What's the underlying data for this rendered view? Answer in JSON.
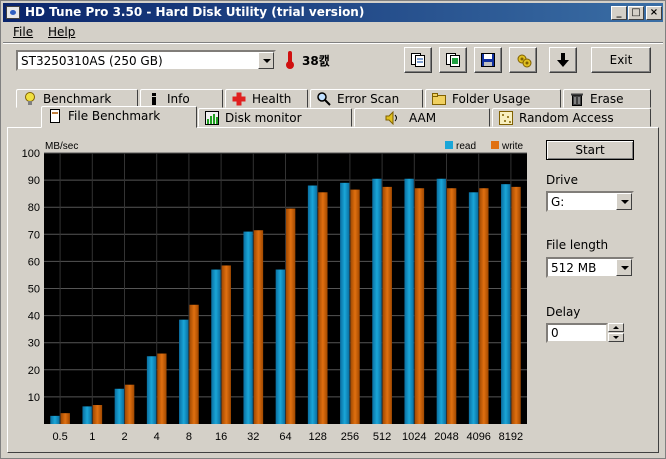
{
  "window": {
    "title": "HD Tune Pro 3.50 - Hard Disk Utility (trial version)",
    "minimize_glyph": "_",
    "maximize_glyph": "□",
    "close_glyph": "×"
  },
  "menu": {
    "items": [
      "File",
      "Help"
    ]
  },
  "toolbar": {
    "drive_select": "ST3250310AS (250 GB)",
    "temperature": "38캜",
    "icons": [
      "copy-info-icon",
      "copy-screenshot-icon",
      "save-icon",
      "options-icon",
      "download-icon"
    ],
    "exit_label": "Exit"
  },
  "tabs": {
    "row1": [
      {
        "label": "Benchmark",
        "icon": "lightbulb-icon"
      },
      {
        "label": "Info",
        "icon": "info-icon"
      },
      {
        "label": "Health",
        "icon": "health-cross-icon"
      },
      {
        "label": "Error Scan",
        "icon": "magnifier-icon"
      },
      {
        "label": "Folder Usage",
        "icon": "folder-icon"
      },
      {
        "label": "Erase",
        "icon": "trash-icon"
      }
    ],
    "row2": [
      {
        "label": "File Benchmark",
        "icon": "file-icon",
        "active": true
      },
      {
        "label": "Disk monitor",
        "icon": "monitor-chart-icon"
      },
      {
        "label": "AAM",
        "icon": "speaker-icon"
      },
      {
        "label": "Random Access",
        "icon": "random-access-icon"
      }
    ]
  },
  "controls": {
    "start_label": "Start",
    "drive_label": "Drive",
    "drive_value": "G:",
    "file_length_label": "File length",
    "file_length_value": "512 MB",
    "delay_label": "Delay",
    "delay_value": "0"
  },
  "colors": {
    "read": "#1aa6d8",
    "write": "#e07010",
    "plot_bg": "#000000",
    "grid": "#555555"
  },
  "chart_data": {
    "type": "bar",
    "ylabel": "MB/sec",
    "ylim": [
      0,
      100
    ],
    "yticks": [
      10,
      20,
      30,
      40,
      50,
      60,
      70,
      80,
      90,
      100
    ],
    "categories": [
      "0.5",
      "1",
      "2",
      "4",
      "8",
      "16",
      "32",
      "64",
      "128",
      "256",
      "512",
      "1024",
      "2048",
      "4096",
      "8192"
    ],
    "series": [
      {
        "name": "read",
        "values": [
          3,
          6.5,
          13,
          25,
          38.5,
          57,
          71,
          57,
          88,
          89,
          90.5,
          90.5,
          90.5,
          85.5,
          88.5
        ]
      },
      {
        "name": "write",
        "values": [
          4,
          7,
          14.5,
          26,
          44,
          58.5,
          71.5,
          79.5,
          85.5,
          86.5,
          87.5,
          87,
          87,
          87,
          87.5
        ]
      }
    ],
    "legend": "top-right",
    "grid": true
  }
}
